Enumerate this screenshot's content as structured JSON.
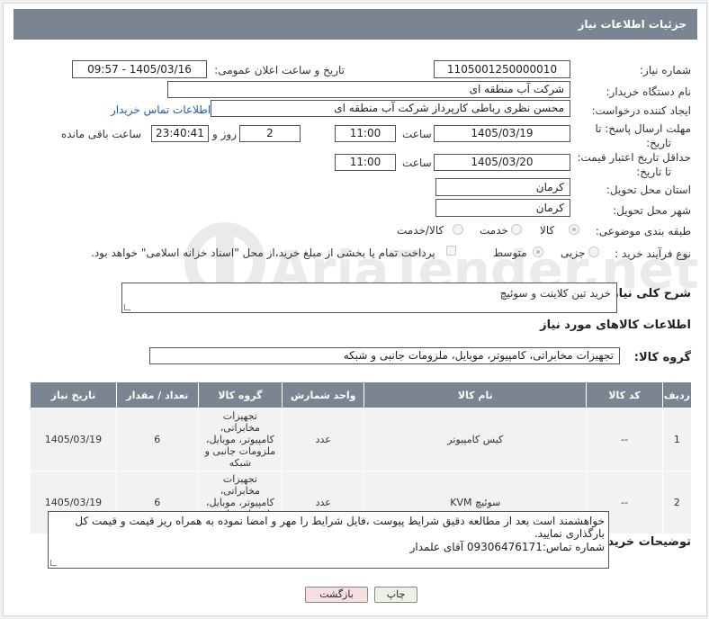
{
  "header": {
    "title": "جزئیات اطلاعات نیاز"
  },
  "form": {
    "need_number_label": "شماره نیاز:",
    "need_number": "1105001250000010",
    "announce_label": "تاریخ و ساعت اعلان عمومی:",
    "announce_value": "1405/03/16 - 09:57",
    "buyer_org_label": "نام دستگاه خریدار:",
    "buyer_org": "شرکت آب منطقه ای",
    "creator_label": "ایجاد کننده درخواست:",
    "creator": "محسن نظری رباطی کارپرداز شرکت آب منطقه ای",
    "buyer_contact_link": "اطلاعات تماس خریدار",
    "deadline_label_1": "مهلت ارسال پاسخ: تا",
    "deadline_label_2": "تاریخ:",
    "deadline_date": "1405/03/19",
    "time_label": "ساعت",
    "deadline_time": "11:00",
    "days_value": "2",
    "days_label": "روز و",
    "remaining_time": "23:40:41",
    "remaining_label": "ساعت باقی مانده",
    "validity_label_1": "حداقل تاریخ اعتبار قیمت:",
    "validity_label_2": "تا تاریخ:",
    "validity_date": "1405/03/20",
    "validity_time": "11:00",
    "province_label": "استان محل تحویل:",
    "province": "کرمان",
    "city_label": "شهر محل تحویل:",
    "city": "کرمان",
    "category_label": "طبقه بندی موضوعی:",
    "category_options": [
      "کالا",
      "خدمت",
      "کالا/خدمت"
    ],
    "process_label": "نوع فرآیند خرید :",
    "process_options": [
      "جزیی",
      "متوسط"
    ],
    "payment_note": "پرداخت تمام یا بخشی از مبلغ خرید،از محل \"اسناد خزانه اسلامی\" خواهد بود."
  },
  "description": {
    "label": "شرح کلی نیاز:",
    "value": "خرید تین کلاینت و سوئیچ"
  },
  "goods": {
    "section_title": "اطلاعات کالاهای مورد نیاز",
    "group_label": "گروه کالا:",
    "group_value": "تجهیزات مخابراتی، کامپیوتر، موبایل، ملزومات جانبی و شبکه",
    "columns": [
      "ردیف",
      "کد کالا",
      "نام کالا",
      "واحد شمارش",
      "گروه کالا",
      "تعداد / مقدار",
      "تاریخ نیاز"
    ],
    "rows": [
      {
        "row": "1",
        "code": "--",
        "name": "کیس کامپیوتر",
        "unit": "عدد",
        "group": "تجهیزات مخابراتی، کامپیوتر، موبایل، ملزومات جانبی و شبکه",
        "qty": "6",
        "date": "1405/03/19"
      },
      {
        "row": "2",
        "code": "--",
        "name": "سوئیچ KVM",
        "unit": "عدد",
        "group": "تجهیزات مخابراتی، کامپیوتر، موبایل، ملزومات جانبی و شبکه",
        "qty": "6",
        "date": "1405/03/19"
      }
    ]
  },
  "buyer_notes": {
    "label": "توضیحات خریدار:",
    "line1": "خواهشمند است بعد از مطالعه دقیق شرایط پیوست ،فایل شرایط را مهر و امضا نموده به همراه ریز قیمت و قیمت کل بارگذاری نمایید.",
    "line2": "شماره تماس:09306476171 آقای علمدار"
  },
  "buttons": {
    "print": "چاپ",
    "back": "بازگشت"
  },
  "watermark": {
    "text": "AriaTender.net"
  },
  "colors": {
    "header_bg": "#7a8591",
    "link": "#1a5fb4",
    "print_btn": "#eaf4e4",
    "back_btn": "#f9e0e0"
  }
}
